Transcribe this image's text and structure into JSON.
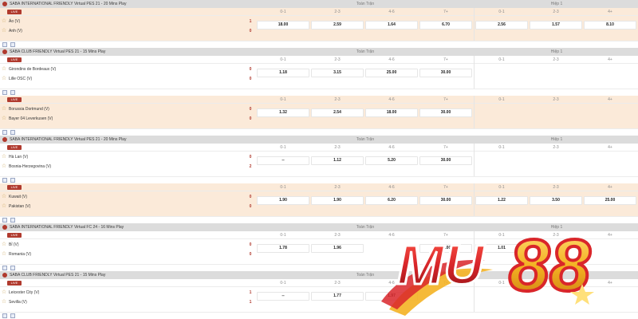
{
  "columns": {
    "section_main": "Toàn Trận",
    "section_half": "Hiệp 1",
    "main_cols": [
      "0-1",
      "2-3",
      "4-6",
      "7+"
    ],
    "half_cols": [
      "0-1",
      "2-3",
      "4+"
    ]
  },
  "leagues": [
    {
      "name": "SABA INTERNATIONAL FRIENDLY Virtual PES 21 - 20 Mins Play",
      "matches": [
        {
          "home": "Áo (V)",
          "away": "Anh (V)",
          "home_score": "1",
          "away_score": "0",
          "main": [
            "18.00",
            "2.59",
            "1.64",
            "6.70"
          ],
          "half": [
            "2.56",
            "1.57",
            "8.10"
          ],
          "shade": "peach"
        }
      ]
    },
    {
      "name": "SABA CLUB FRIENDLY Virtual PES 21 - 15 Mins Play",
      "matches": [
        {
          "home": "Girondins de Bordeaux (V)",
          "away": "Lille OSC (V)",
          "home_score": "0",
          "away_score": "0",
          "main": [
            "1.18",
            "3.15",
            "25.00",
            "30.00"
          ],
          "half": [
            "",
            "",
            ""
          ],
          "shade": "white"
        },
        {
          "home": "Borussia Dortmund (V)",
          "away": "Bayer 04 Leverkusen (V)",
          "home_score": "0",
          "away_score": "0",
          "main": [
            "1.32",
            "2.54",
            "18.00",
            "30.00"
          ],
          "half": [
            "",
            "",
            ""
          ],
          "shade": "peach"
        }
      ]
    },
    {
      "name": "SABA INTERNATIONAL FRIENDLY Virtual PES 21 - 20 Mins Play",
      "matches": [
        {
          "home": "Hà Lan (V)",
          "away": "Bosnia-Herzegovina (V)",
          "home_score": "0",
          "away_score": "2",
          "main": [
            "--",
            "1.12",
            "5.20",
            "30.00"
          ],
          "half": [
            "",
            "",
            ""
          ],
          "shade": "white"
        },
        {
          "home": "Kuwait (V)",
          "away": "Pakistan (V)",
          "home_score": "0",
          "away_score": "0",
          "main": [
            "1.90",
            "1.90",
            "6.20",
            "30.00"
          ],
          "half": [
            "1.22",
            "3.50",
            "25.00"
          ],
          "shade": "peach"
        }
      ]
    },
    {
      "name": "SABA INTERNATIONAL FRIENDLY Virtual FC 24 - 16 Mins Play",
      "matches": [
        {
          "home": "Bỉ (V)",
          "away": "Romania (V)",
          "home_score": "0",
          "away_score": "0",
          "main": [
            "1.78",
            "1.96",
            "",
            "30.00"
          ],
          "half": [
            "1.01",
            "",
            ""
          ],
          "shade": "white"
        }
      ]
    },
    {
      "name": "SABA CLUB FRIENDLY Virtual PES 21 - 15 Mins Play",
      "matches": [
        {
          "home": "Leicester City (V)",
          "away": "Sevilla (V)",
          "home_score": "1",
          "away_score": "1",
          "main": [
            "--",
            "1.77",
            "1.97",
            ""
          ],
          "half": [
            "",
            "",
            ""
          ],
          "shade": "white"
        }
      ]
    }
  ],
  "live_badge": "LIVE",
  "watermark": {
    "text": "MU88",
    "color_red": "#d9262a",
    "color_gold": "#f4b223"
  },
  "icons": {
    "favorite": "star-icon",
    "league": "league-ball-icon",
    "more": "plus-icon",
    "stats": "stats-icon"
  }
}
